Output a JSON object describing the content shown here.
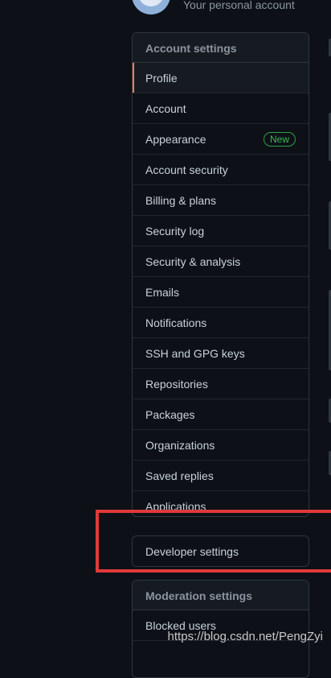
{
  "header": {
    "personal_label": "Your personal account"
  },
  "account_menu": {
    "title": "Account settings",
    "items": [
      {
        "label": "Profile"
      },
      {
        "label": "Account"
      },
      {
        "label": "Appearance",
        "badge": "New"
      },
      {
        "label": "Account security"
      },
      {
        "label": "Billing & plans"
      },
      {
        "label": "Security log"
      },
      {
        "label": "Security & analysis"
      },
      {
        "label": "Emails"
      },
      {
        "label": "Notifications"
      },
      {
        "label": "SSH and GPG keys"
      },
      {
        "label": "Repositories"
      },
      {
        "label": "Packages"
      },
      {
        "label": "Organizations"
      },
      {
        "label": "Saved replies"
      },
      {
        "label": "Applications"
      }
    ]
  },
  "developer_menu": {
    "label": "Developer settings"
  },
  "moderation_menu": {
    "title": "Moderation settings",
    "items": [
      {
        "label": "Blocked users"
      }
    ]
  },
  "watermark": "https://blog.csdn.net/PengZyi",
  "colors": {
    "background": "#0d1117",
    "selected_accent": "#f78166",
    "badge_green": "#3fb950",
    "highlight_red": "#e03a3a"
  }
}
